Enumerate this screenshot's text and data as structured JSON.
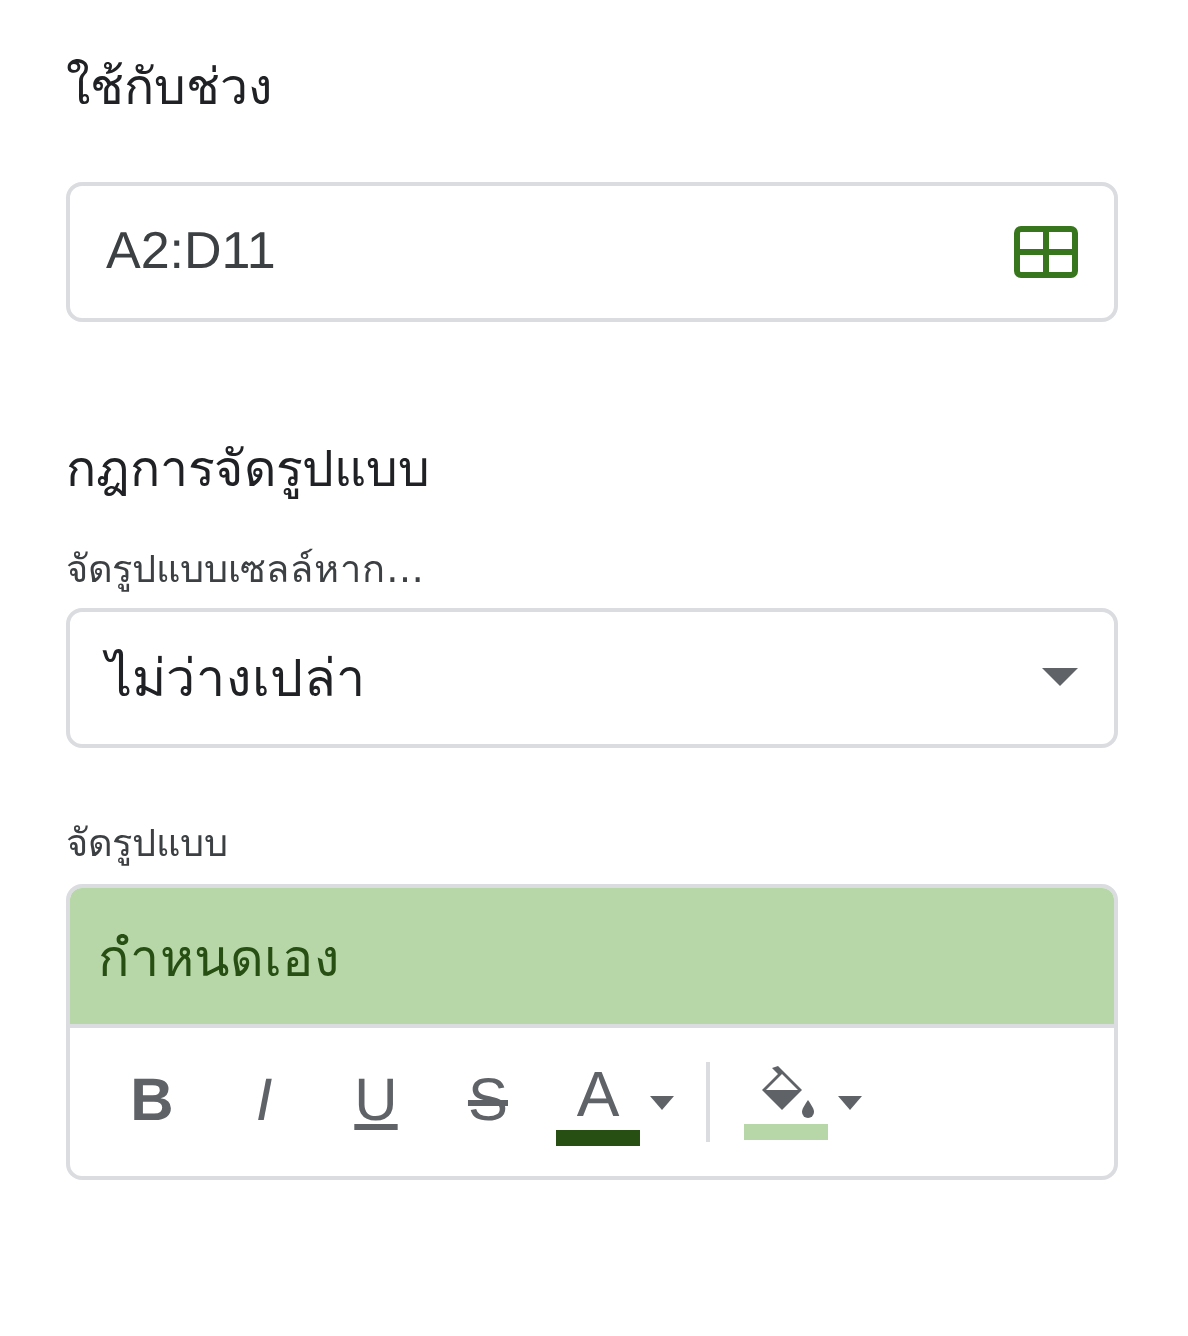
{
  "range_section": {
    "title": "ใช้กับช่วง",
    "range_value": "A2:D11"
  },
  "rules_section": {
    "title": "กฎการจัดรูปแบบ",
    "condition_label": "จัดรูปแบบเซลล์หาก…",
    "condition_value": "ไม่ว่างเปล่า",
    "style_label": "จัดรูปแบบ",
    "preview_text": "กำหนดเอง",
    "toolbar": [
      {
        "kind": "bold",
        "label": "B",
        "selected": false
      },
      {
        "kind": "italic",
        "label": "I",
        "selected": false
      },
      {
        "kind": "underline",
        "label": "U",
        "selected": false
      },
      {
        "kind": "strikethrough",
        "label": "S",
        "selected": false
      },
      {
        "kind": "text-color",
        "label": "A",
        "color": "#274e13"
      },
      {
        "kind": "fill-color",
        "color": "#b7d7a8"
      }
    ]
  }
}
